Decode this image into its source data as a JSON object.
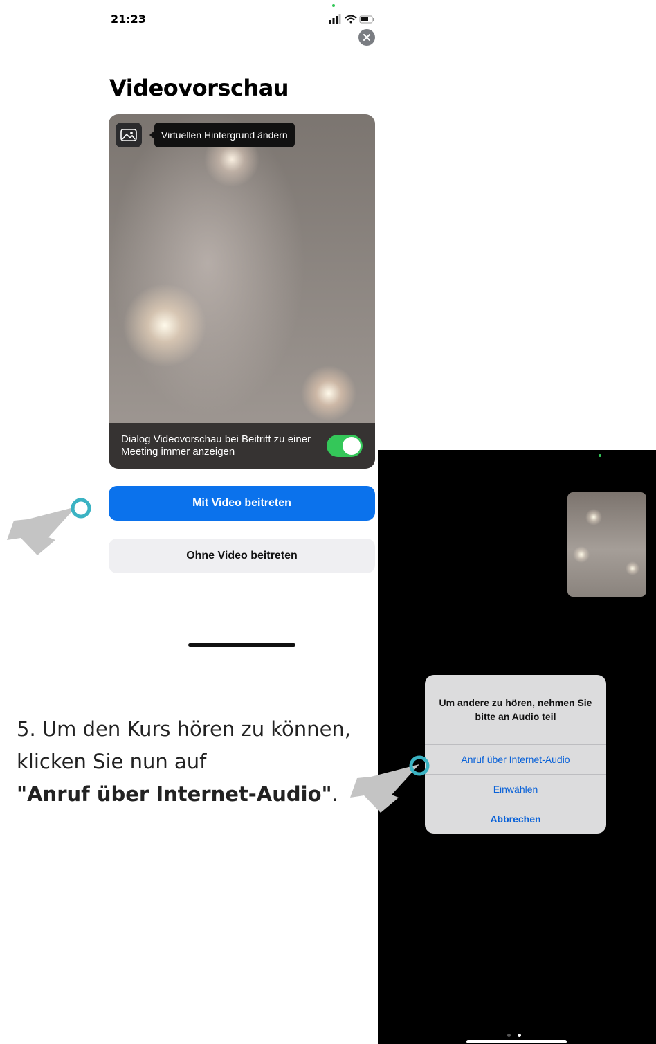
{
  "status_bar": {
    "time": "21:23"
  },
  "screen1": {
    "title": "Videovorschau",
    "tooltip": "Virtuellen Hintergrund ändern",
    "preview_setting": {
      "label": "Dialog Videovorschau bei Beitritt zu einer Meeting immer anzeigen",
      "toggle_on": true
    },
    "buttons": {
      "join_with_video": "Mit Video beitreten",
      "join_without_video": "Ohne Video beitreten"
    }
  },
  "instruction": {
    "line1": "5. Um den Kurs hören zu können,",
    "line2": "klicken Sie nun auf",
    "line3_bold": "\"Anruf über Internet-Audio\"",
    "line3_tail": "."
  },
  "screen2": {
    "dialog": {
      "message": "Um andere zu hören, nehmen Sie bitte an Audio teil",
      "options": [
        "Anruf über Internet-Audio",
        "Einwählen",
        "Abbrechen"
      ]
    }
  },
  "colors": {
    "primary_blue": "#0b72ec",
    "toggle_green": "#34c759",
    "pointer_gray": "#c4c4c4",
    "pointer_ring": "#3bb3c3",
    "link_blue": "#0a62d8"
  },
  "icons": [
    "close-icon",
    "image-icon",
    "signal-icon",
    "wifi-icon",
    "battery-icon",
    "pointer-arrow-icon"
  ]
}
